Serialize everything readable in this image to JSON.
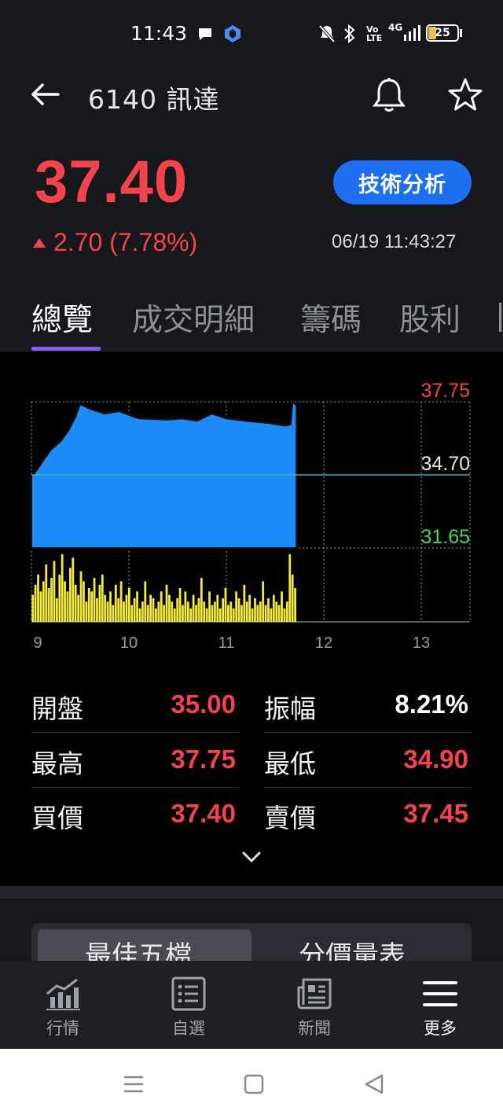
{
  "status_bar": {
    "time": "11:43",
    "battery": "25",
    "network": "4G"
  },
  "header": {
    "title": "6140 訊達"
  },
  "quote": {
    "price": "37.40",
    "change": "2.70 (7.78%)",
    "datetime": "06/19 11:43:27",
    "analysis_button": "技術分析",
    "up_color": "#f4434a"
  },
  "tabs": [
    {
      "label": "總覽",
      "active": true
    },
    {
      "label": "成交明細",
      "active": false
    },
    {
      "label": "籌碼",
      "active": false
    },
    {
      "label": "股利",
      "active": false
    }
  ],
  "chart_data": {
    "type": "area",
    "price_labels": {
      "high": "37.75",
      "ref": "34.70",
      "low": "31.65"
    },
    "x_ticks": [
      "9",
      "10",
      "11",
      "12",
      "13"
    ],
    "ylim": [
      31.65,
      37.75
    ],
    "reference": 34.7,
    "price_series": [
      {
        "t": 9.0,
        "v": 34.7
      },
      {
        "t": 9.03,
        "v": 34.75
      },
      {
        "t": 9.08,
        "v": 35.05
      },
      {
        "t": 9.13,
        "v": 35.35
      },
      {
        "t": 9.2,
        "v": 35.75
      },
      {
        "t": 9.3,
        "v": 36.1
      },
      {
        "t": 9.38,
        "v": 36.55
      },
      {
        "t": 9.45,
        "v": 37.1
      },
      {
        "t": 9.5,
        "v": 37.65
      },
      {
        "t": 9.6,
        "v": 37.45
      },
      {
        "t": 9.75,
        "v": 37.25
      },
      {
        "t": 9.9,
        "v": 37.35
      },
      {
        "t": 10.1,
        "v": 37.05
      },
      {
        "t": 10.4,
        "v": 37.0
      },
      {
        "t": 10.55,
        "v": 37.05
      },
      {
        "t": 10.7,
        "v": 36.95
      },
      {
        "t": 10.85,
        "v": 37.25
      },
      {
        "t": 11.0,
        "v": 37.05
      },
      {
        "t": 11.2,
        "v": 36.95
      },
      {
        "t": 11.45,
        "v": 36.85
      },
      {
        "t": 11.6,
        "v": 36.75
      },
      {
        "t": 11.66,
        "v": 36.8
      },
      {
        "t": 11.68,
        "v": 37.75
      },
      {
        "t": 11.72,
        "v": 37.6
      }
    ],
    "volume_series": [
      40,
      55,
      70,
      45,
      60,
      85,
      50,
      65,
      90,
      35,
      70,
      100,
      60,
      45,
      80,
      95,
      55,
      40,
      75,
      60,
      30,
      50,
      45,
      65,
      35,
      55,
      70,
      40,
      30,
      45,
      25,
      55,
      35,
      60,
      30,
      40,
      50,
      25,
      35,
      45,
      20,
      30,
      60,
      25,
      40,
      35,
      20,
      30,
      45,
      25,
      55,
      40,
      30,
      20,
      35,
      50,
      25,
      45,
      30,
      20,
      40,
      25,
      35,
      65,
      30,
      20,
      45,
      25,
      30,
      40,
      20,
      35,
      50,
      25,
      30,
      20,
      45,
      35,
      25,
      55,
      30,
      40,
      20,
      35,
      25,
      30,
      60,
      25,
      35,
      20,
      40,
      30,
      25,
      45,
      20,
      30,
      100,
      70,
      50
    ]
  },
  "stats": [
    {
      "left_label": "開盤",
      "left_value": "35.00",
      "right_label": "振幅",
      "right_value": "8.21%"
    },
    {
      "left_label": "最高",
      "left_value": "37.75",
      "right_label": "最低",
      "right_value": "34.90"
    },
    {
      "left_label": "買價",
      "left_value": "37.40",
      "right_label": "賣價",
      "right_value": "37.45"
    }
  ],
  "segments": {
    "best_five": "最佳五檔",
    "price_volume": "分價量表"
  },
  "bottom_nav": [
    {
      "label": "行情",
      "icon": "chart-bars-icon",
      "active": false
    },
    {
      "label": "自選",
      "icon": "list-icon",
      "active": false
    },
    {
      "label": "新聞",
      "icon": "news-icon",
      "active": false
    },
    {
      "label": "更多",
      "icon": "menu-icon",
      "active": true
    }
  ]
}
